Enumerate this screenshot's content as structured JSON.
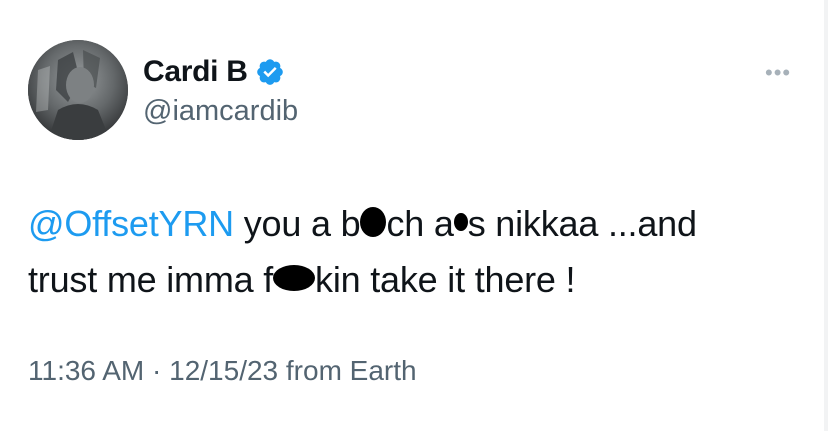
{
  "tweet": {
    "author_name": "Cardi B",
    "author_handle": "@iamcardib",
    "verified_icon": "verified-badge-icon",
    "more_icon": "more-icon",
    "more_label": "•••",
    "body": {
      "mention": "@OffsetYRN",
      "line1_part1": " you a b",
      "line1_part2": "ch a",
      "line1_part3": "s nikkaa ...and",
      "line2_part1": "trust me imma f",
      "line2_part2": "kin take it there !"
    },
    "time": "11:36 AM",
    "separator": "·",
    "date": "12/15/23",
    "source": "from Earth"
  },
  "colors": {
    "accent": "#1d9bf0",
    "text": "#0f1419",
    "muted": "#536471"
  }
}
